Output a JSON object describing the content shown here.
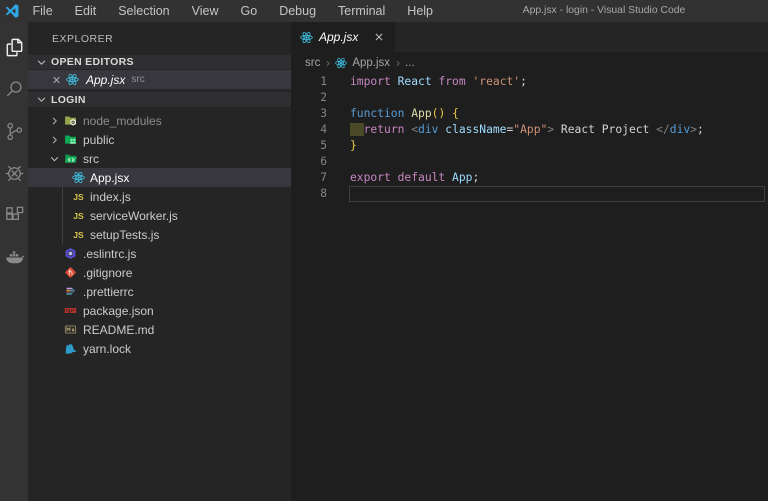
{
  "title_bar": {
    "menus": [
      "File",
      "Edit",
      "Selection",
      "View",
      "Go",
      "Debug",
      "Terminal",
      "Help"
    ],
    "title": "App.jsx - login - Visual Studio Code"
  },
  "activity_bar": {
    "items": [
      {
        "id": "explorer",
        "icon": "files-icon",
        "active": true
      },
      {
        "id": "search",
        "icon": "search-icon",
        "active": false
      },
      {
        "id": "source-control",
        "icon": "source-control-icon",
        "active": false
      },
      {
        "id": "debug",
        "icon": "debug-icon",
        "active": false
      },
      {
        "id": "extensions",
        "icon": "extensions-icon",
        "active": false
      },
      {
        "id": "docker",
        "icon": "docker-icon",
        "active": false
      }
    ]
  },
  "sidebar": {
    "title": "EXPLORER",
    "open_editors_header": "OPEN EDITORS",
    "open_editors": [
      {
        "label": "App.jsx",
        "description": "src",
        "icon": "react-icon",
        "preview": true,
        "selected": true
      }
    ],
    "folder_header": "LOGIN",
    "tree": [
      {
        "label": "node_modules",
        "icon": "folder-node-modules-icon",
        "level": 1,
        "chevron": "right",
        "dimmed": true
      },
      {
        "label": "public",
        "icon": "folder-public-icon",
        "level": 1,
        "chevron": "right"
      },
      {
        "label": "src",
        "icon": "folder-src-open-icon",
        "level": 1,
        "chevron": "down"
      },
      {
        "label": "App.jsx",
        "icon": "react-icon",
        "level": 2,
        "selected": true
      },
      {
        "label": "index.js",
        "icon": "js-icon",
        "level": 2
      },
      {
        "label": "serviceWorker.js",
        "icon": "js-icon",
        "level": 2
      },
      {
        "label": "setupTests.js",
        "icon": "js-icon",
        "level": 2
      },
      {
        "label": ".eslintrc.js",
        "icon": "eslint-icon",
        "level": 1
      },
      {
        "label": ".gitignore",
        "icon": "git-icon",
        "level": 1
      },
      {
        "label": ".prettierrc",
        "icon": "prettier-icon",
        "level": 1
      },
      {
        "label": "package.json",
        "icon": "npm-icon",
        "level": 1
      },
      {
        "label": "README.md",
        "icon": "markdown-icon",
        "level": 1
      },
      {
        "label": "yarn.lock",
        "icon": "yarn-icon",
        "level": 1
      }
    ]
  },
  "editor": {
    "tab": {
      "label": "App.jsx",
      "icon": "react-icon",
      "active": true,
      "preview": true
    },
    "breadcrumbs": [
      {
        "label": "src"
      },
      {
        "label": "App.jsx",
        "icon": "react-icon"
      },
      {
        "label": "..."
      }
    ],
    "code_lines": [
      {
        "num": "1",
        "tokens": [
          {
            "t": "import",
            "c": "keyword"
          },
          {
            "t": " ",
            "c": "default"
          },
          {
            "t": "React",
            "c": "variable"
          },
          {
            "t": " ",
            "c": "default"
          },
          {
            "t": "from",
            "c": "keyword"
          },
          {
            "t": " ",
            "c": "default"
          },
          {
            "t": "'react'",
            "c": "string"
          },
          {
            "t": ";",
            "c": "default"
          }
        ]
      },
      {
        "num": "2",
        "tokens": []
      },
      {
        "num": "3",
        "tokens": [
          {
            "t": "function",
            "c": "storage"
          },
          {
            "t": " ",
            "c": "default"
          },
          {
            "t": "App",
            "c": "function"
          },
          {
            "t": "()",
            "c": "bracket"
          },
          {
            "t": " ",
            "c": "default"
          },
          {
            "t": "{",
            "c": "bracket"
          }
        ]
      },
      {
        "num": "4",
        "tokens": [
          {
            "t": "  ",
            "c": "default",
            "sel": true
          },
          {
            "t": "return",
            "c": "keyword"
          },
          {
            "t": " ",
            "c": "default"
          },
          {
            "t": "<",
            "c": "punct"
          },
          {
            "t": "div",
            "c": "tag"
          },
          {
            "t": " ",
            "c": "default"
          },
          {
            "t": "className",
            "c": "attr"
          },
          {
            "t": "=",
            "c": "default"
          },
          {
            "t": "\"App\"",
            "c": "string"
          },
          {
            "t": ">",
            "c": "punct"
          },
          {
            "t": " React Project ",
            "c": "default"
          },
          {
            "t": "</",
            "c": "punct"
          },
          {
            "t": "div",
            "c": "tag"
          },
          {
            "t": ">",
            "c": "punct"
          },
          {
            "t": ";",
            "c": "default"
          }
        ]
      },
      {
        "num": "5",
        "tokens": [
          {
            "t": "}",
            "c": "bracket"
          }
        ]
      },
      {
        "num": "6",
        "tokens": []
      },
      {
        "num": "7",
        "tokens": [
          {
            "t": "export",
            "c": "keyword"
          },
          {
            "t": " ",
            "c": "default"
          },
          {
            "t": "default",
            "c": "keyword"
          },
          {
            "t": " ",
            "c": "default"
          },
          {
            "t": "App",
            "c": "variable"
          },
          {
            "t": ";",
            "c": "default"
          }
        ]
      },
      {
        "num": "8",
        "tokens": [],
        "current": true
      }
    ]
  },
  "colors": {
    "titlebar_bg": "#323233",
    "activitybar_bg": "#333333",
    "sidebar_bg": "#252526",
    "editor_bg": "#1e1e1e",
    "selection_row_bg": "#37373d",
    "accent_react": "#3fc6e8",
    "indent_highlight": "#4b4a27"
  }
}
